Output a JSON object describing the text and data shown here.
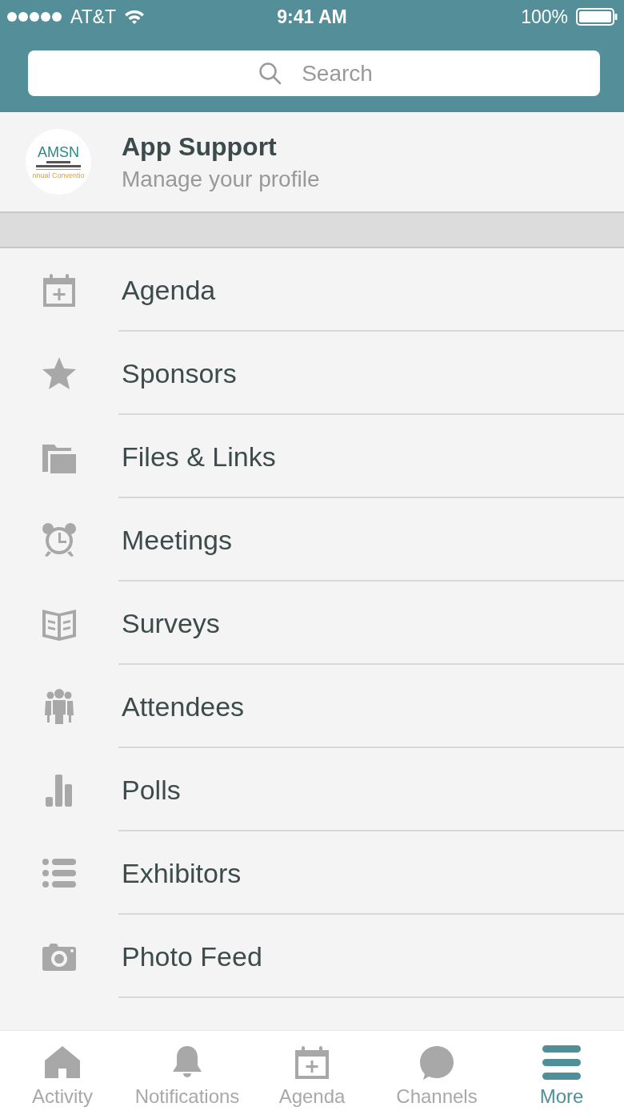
{
  "status_bar": {
    "carrier": "AT&T",
    "time": "9:41 AM",
    "battery": "100%"
  },
  "search": {
    "placeholder": "Search"
  },
  "profile": {
    "logo": [
      "AMSN",
      "nnual Conventio"
    ],
    "title": "App Support",
    "subtitle": "Manage your profile"
  },
  "menu": [
    {
      "kind": "calendar",
      "label": "Agenda"
    },
    {
      "kind": "star",
      "label": "Sponsors"
    },
    {
      "kind": "folder",
      "label": "Files & Links"
    },
    {
      "kind": "alarm",
      "label": "Meetings"
    },
    {
      "kind": "book",
      "label": "Surveys"
    },
    {
      "kind": "people",
      "label": "Attendees"
    },
    {
      "kind": "bars",
      "label": "Polls"
    },
    {
      "kind": "list",
      "label": "Exhibitors"
    },
    {
      "kind": "camera",
      "label": "Photo Feed"
    }
  ],
  "tabs": [
    {
      "kind": "home",
      "label": "Activity",
      "selected": false
    },
    {
      "kind": "bell",
      "label": "Notifications",
      "selected": false
    },
    {
      "kind": "calendar",
      "label": "Agenda",
      "selected": false
    },
    {
      "kind": "chat",
      "label": "Channels",
      "selected": false
    },
    {
      "kind": "menu",
      "label": "More",
      "selected": true
    }
  ]
}
